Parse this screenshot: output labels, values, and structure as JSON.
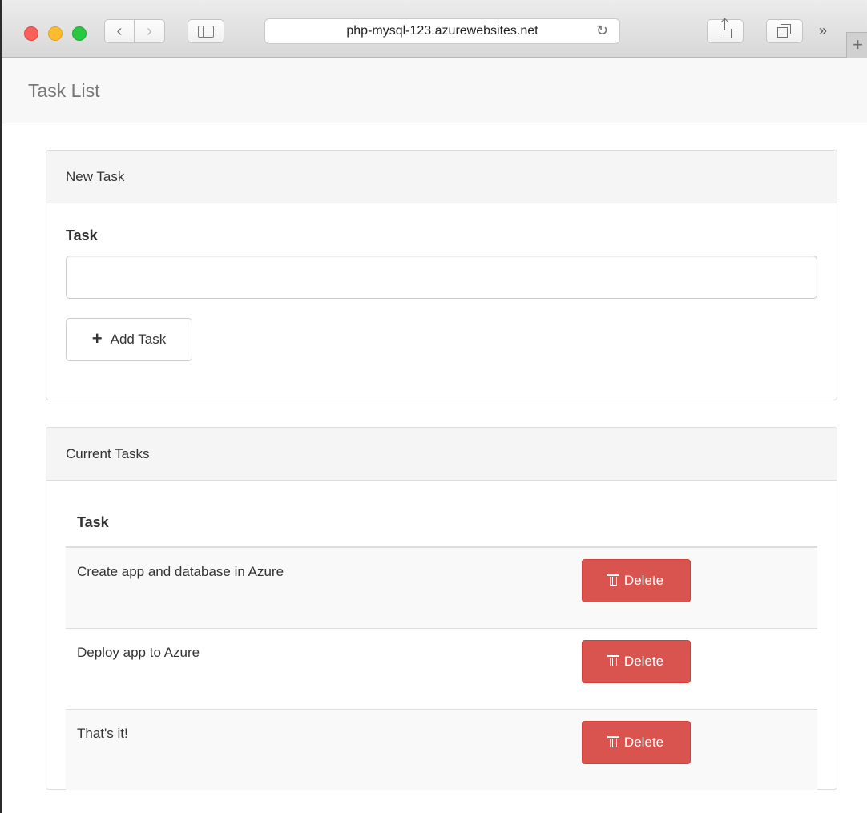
{
  "browser": {
    "url": "php-mysql-123.azurewebsites.net",
    "icons": [
      "back-icon",
      "forward-icon",
      "sidebar-icon",
      "reload-icon",
      "share-icon",
      "tabs-icon",
      "more-icon",
      "new-tab-icon"
    ]
  },
  "navbar": {
    "brand": "Task List"
  },
  "new_task_panel": {
    "heading": "New Task",
    "field_label": "Task",
    "input_value": "",
    "add_button_label": "Add Task"
  },
  "current_tasks_panel": {
    "heading": "Current Tasks",
    "column_header": "Task",
    "delete_label": "Delete",
    "tasks": [
      {
        "name": "Create app and database in Azure"
      },
      {
        "name": "Deploy app to Azure"
      },
      {
        "name": "That's it!"
      }
    ]
  },
  "colors": {
    "danger": "#d9534f",
    "panel_heading_bg": "#f5f5f5",
    "navbar_bg": "#f8f8f8"
  }
}
